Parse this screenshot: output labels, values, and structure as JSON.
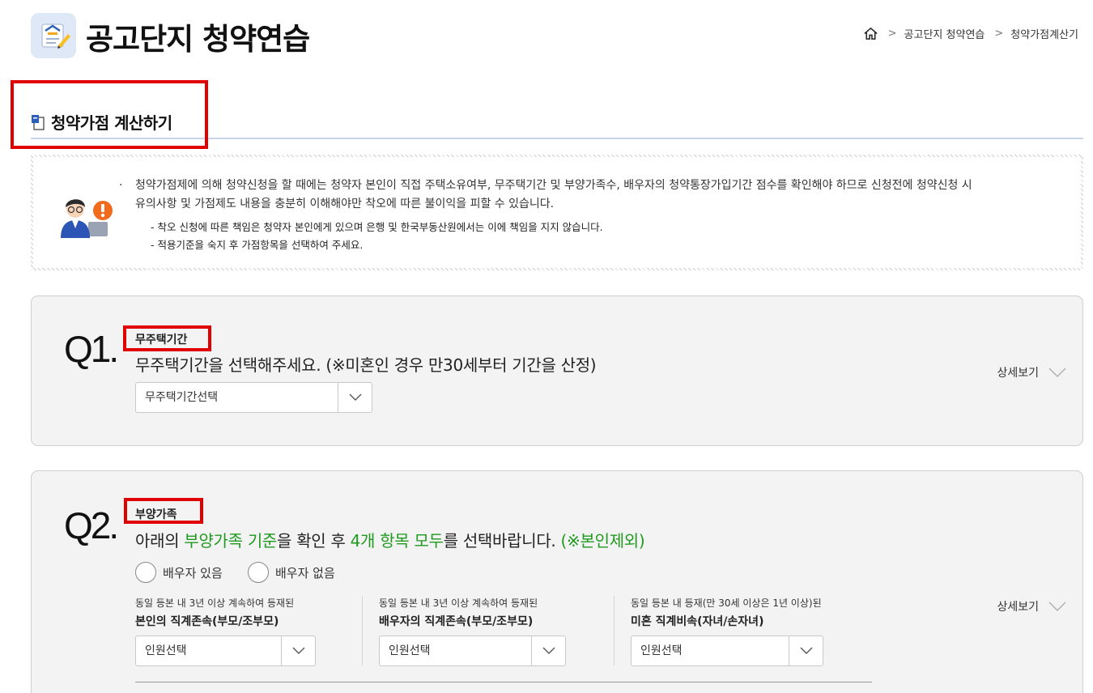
{
  "header": {
    "title": "공고단지 청약연습",
    "breadcrumb": [
      "공고단지 청약연습",
      "청약가점계산기"
    ]
  },
  "section": {
    "title": "청약가점 계산하기"
  },
  "notice": {
    "main_line1": "청약가점제에 의해 청약신청을 할 때에는 청약자 본인이 직접 주택소유여부, 무주택기간 및 부양가족수, 배우자의 청약통장가입기간 점수를 확인해야 하므로 신청전에 청약신청 시",
    "main_line2": "유의사항 및 가점제도 내용을 충분히 이해해야만 착오에 따른 불이익을 피할 수 있습니다.",
    "bullet": "·",
    "sub1": "- 착오 신청에 따른 책임은 청약자 본인에게 있으며 은행 및 한국부동산원에서는 이에 책임을 지지 않습니다.",
    "sub2": "- 적용기준을 숙지 후 가점항목을 선택하여 주세요."
  },
  "q1": {
    "number": "Q1.",
    "tag": "무주택기간",
    "question": "무주택기간을 선택해주세요. (※미혼인 경우 만30세부터 기간을 산정)",
    "select_value": "무주택기간선택",
    "detail_label": "상세보기"
  },
  "q2": {
    "number": "Q2.",
    "tag": "부양가족",
    "question_parts": [
      "아래의 ",
      "부양가족 기준",
      "을 확인 후 ",
      "4개 항목 모두",
      "를 선택바랍니다. ",
      "(※본인제외)"
    ],
    "radio_spouse_yes": "배우자 있음",
    "radio_spouse_no": "배우자 없음",
    "detail_label": "상세보기",
    "columns": [
      {
        "desc": "동일 등본 내 3년 이상 계속하여 등재된",
        "label": "본인의 직계존속(부모/조부모)",
        "select_value": "인원선택"
      },
      {
        "desc": "동일 등본 내 3년 이상 계속하여 등재된",
        "label": "배우자의 직계존속(부모/조부모)",
        "select_value": "인원선택"
      },
      {
        "desc": "동일 등본 내 등재(만 30세 이상은 1년 이상)된",
        "label": "미혼 직계비속(자녀/손자녀)",
        "select_value": "인원선택"
      }
    ]
  },
  "colors": {
    "accent_green": "#1f9a1f",
    "highlight_red": "#e00000",
    "card_bg": "#f3f3f3"
  }
}
